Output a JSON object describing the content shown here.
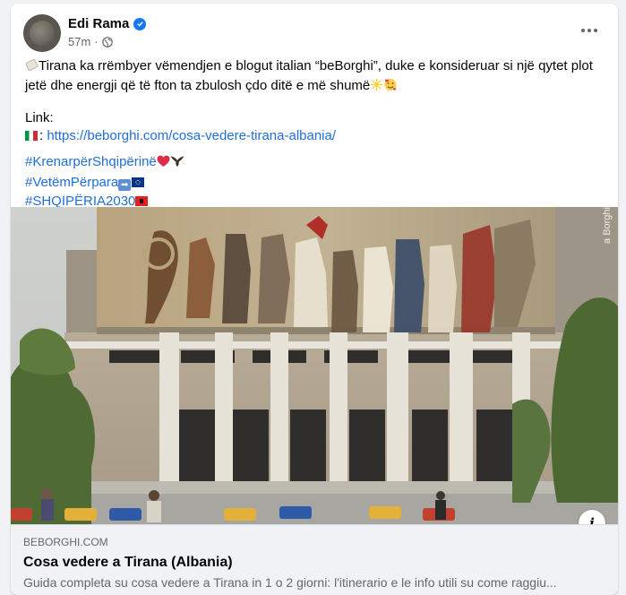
{
  "post": {
    "author": "Edi Rama",
    "time": "57m",
    "verified": true,
    "paragraph1": "Tirana ka rrëmbyer vëmendjen e blogut italian “beBorghi”, duke e konsideruar si një qytet plot jetë dhe energji që të fton ta zbulosh çdo ditë e më shumë",
    "link_label": "Link:",
    "link_sep": ": ",
    "link_url": "https://beborghi.com/cosa-vedere-tirana-albania/",
    "hashtags": [
      "#KrenarpërShqipërinë",
      "#VetëmPërpara",
      "#SHQIPËRIA2030"
    ]
  },
  "media": {
    "watermark": "a Borghi"
  },
  "preview": {
    "domain": "BEBORGHI.COM",
    "title": "Cosa vedere a Tirana (Albania)",
    "description": "Guida completa su cosa vedere a Tirana in 1 o 2 giorni: l'itinerario e le info utili su come raggiu..."
  },
  "icons": {
    "verified": "verified-badge-icon",
    "globe": "globe-icon",
    "more": "more-options-icon",
    "info": "info-icon"
  },
  "colors": {
    "accent": "#1877f2",
    "link": "#216fdb",
    "secondary_text": "#65676b",
    "background": "#f0f2f5"
  }
}
